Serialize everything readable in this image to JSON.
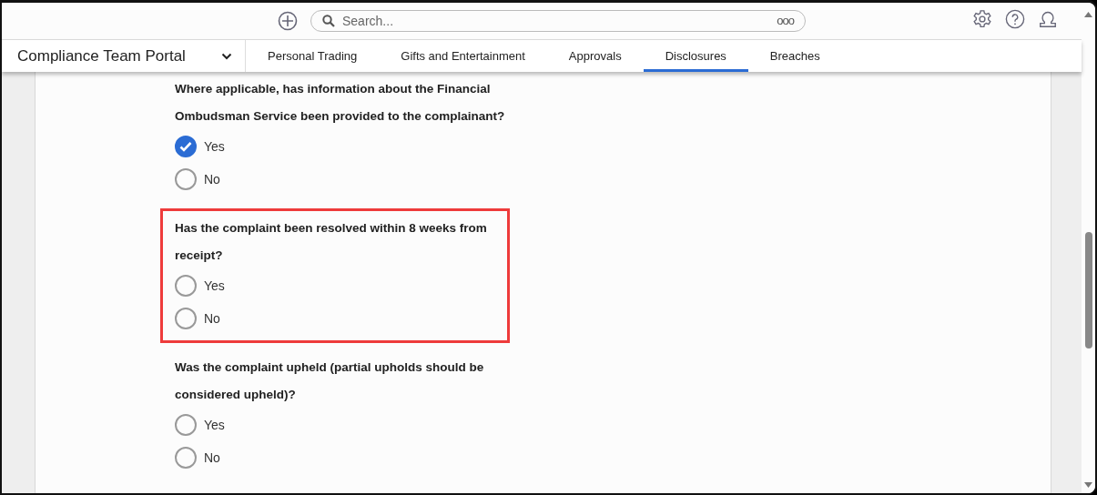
{
  "top_bar": {
    "search": {
      "placeholder": "Search..."
    },
    "search_more": "ooo"
  },
  "nav": {
    "portal": "Compliance Team Portal",
    "tabs": [
      {
        "label": "Personal Trading",
        "selected": false
      },
      {
        "label": "Gifts and Entertainment",
        "selected": false
      },
      {
        "label": "Approvals",
        "selected": false
      },
      {
        "label": "Disclosures",
        "selected": true
      },
      {
        "label": "Breaches",
        "selected": false
      }
    ]
  },
  "questions": [
    {
      "text": "Where applicable, has information about the Financial Ombudsman Service been provided to the complainant?",
      "highlighted": false,
      "options": [
        {
          "label": "Yes",
          "selected": true
        },
        {
          "label": "No",
          "selected": false
        }
      ]
    },
    {
      "text": "Has the complaint been resolved within 8 weeks from receipt?",
      "highlighted": true,
      "options": [
        {
          "label": "Yes",
          "selected": false
        },
        {
          "label": "No",
          "selected": false
        }
      ]
    },
    {
      "text": "Was the complaint upheld (partial upholds should be considered upheld)?",
      "highlighted": false,
      "options": [
        {
          "label": "Yes",
          "selected": false
        },
        {
          "label": "No",
          "selected": false
        }
      ]
    }
  ]
}
